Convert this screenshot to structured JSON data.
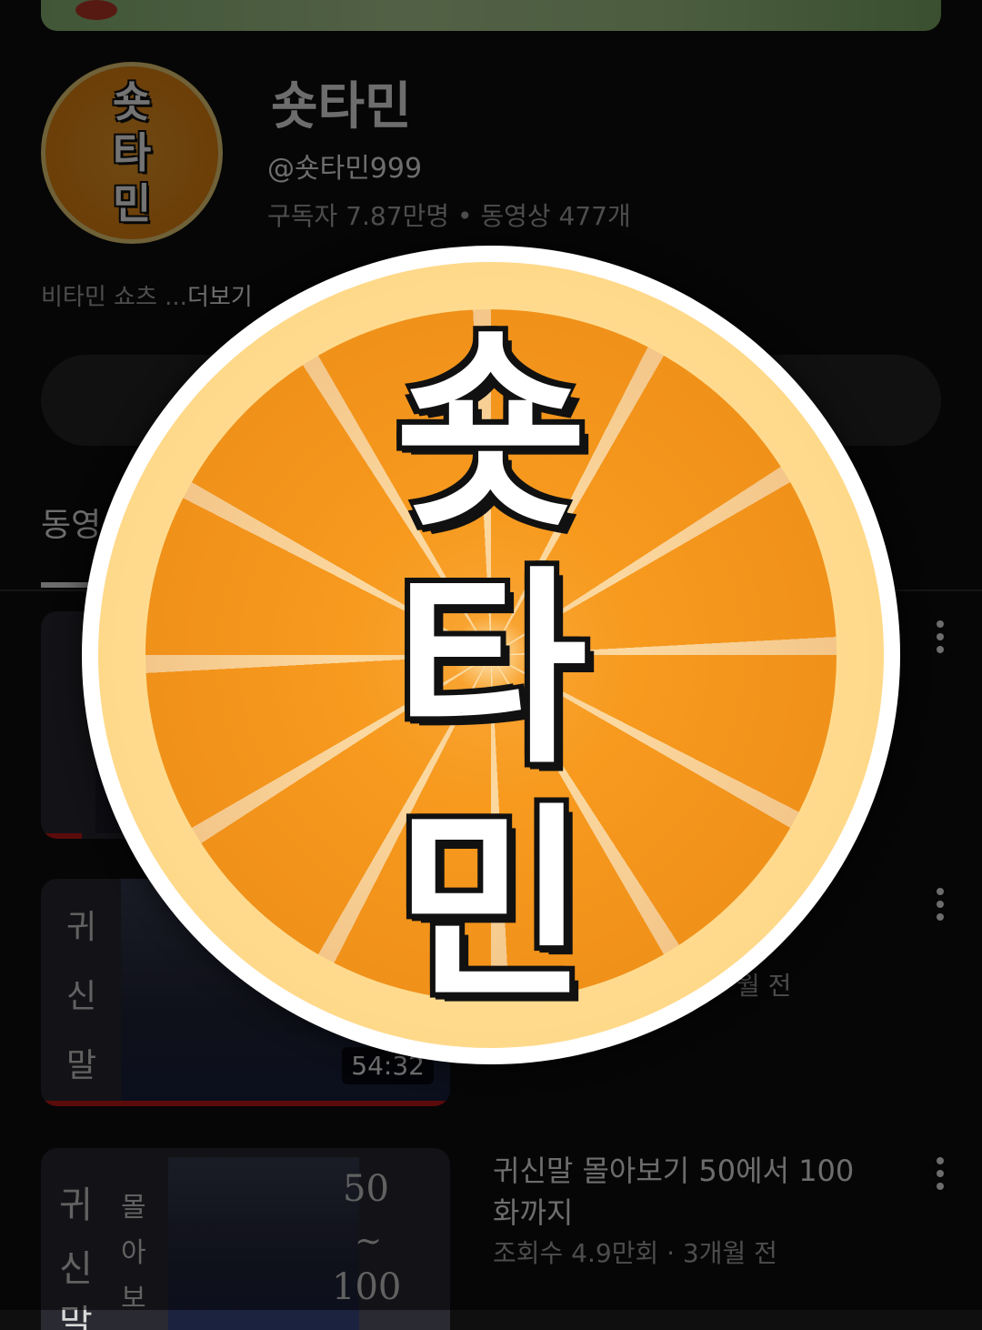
{
  "channel": {
    "name": "숏타민",
    "handle": "@숏타민999",
    "stats": "구독자 7.87만명 • 동영상 477개",
    "description": "비타민 쇼츠 ...",
    "more_label": "더보기",
    "logo_lines": [
      "숏",
      "타",
      "민"
    ]
  },
  "tabs": {
    "active_label": "동영상"
  },
  "videos": [
    {
      "title": "",
      "meta": "",
      "duration": "",
      "thumb_text": []
    },
    {
      "title": "",
      "meta": "월 전",
      "duration": "54:32",
      "thumb_text": [
        "귀",
        "신",
        "말"
      ]
    },
    {
      "title": "귀신말 몰아보기 50에서 100화까지",
      "meta": "조회수 4.9만회 · 3개월 전",
      "duration": "",
      "thumb_text": [
        "귀",
        "신",
        "말",
        "몰",
        "아",
        "보",
        "50",
        "~",
        "100"
      ]
    }
  ],
  "colors": {
    "background": "#0f0f0f",
    "accent_progress": "#cc1a1a",
    "avatar_orange": "#f79a1e"
  }
}
